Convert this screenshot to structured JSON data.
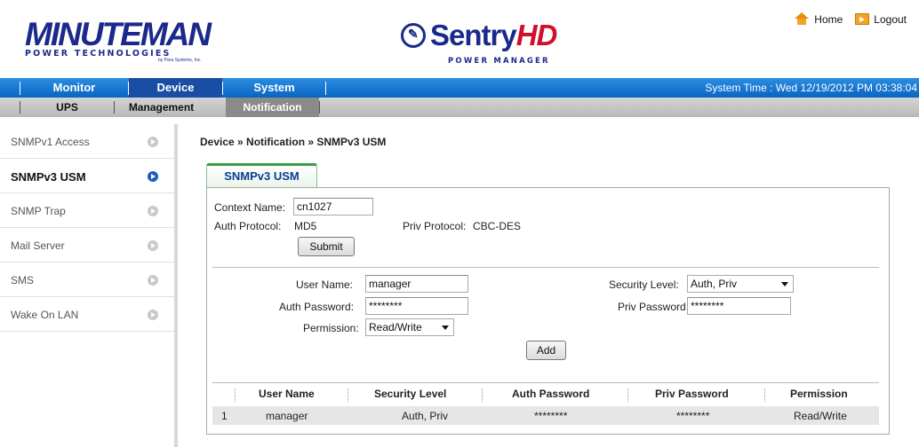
{
  "header": {
    "brand_main": "MINUTEMAN",
    "brand_sub": "POWER TECHNOLOGIES",
    "brand_sub2": "by Para Systems, Inc.",
    "product_name_a": "Sentry",
    "product_name_b": "HD",
    "product_sub": "POWER MANAGER",
    "home_label": "Home",
    "logout_label": "Logout"
  },
  "main_nav": {
    "tabs": [
      {
        "label": "Monitor"
      },
      {
        "label": "Device"
      },
      {
        "label": "System"
      }
    ],
    "active": "Device",
    "system_time": "System Time : Wed 12/19/2012 PM 03:38:04"
  },
  "sub_nav": {
    "tabs": [
      {
        "label": "UPS"
      },
      {
        "label": "Management"
      },
      {
        "label": "Notification"
      }
    ],
    "active": "Notification"
  },
  "sidebar": {
    "items": [
      {
        "label": "SNMPv1 Access"
      },
      {
        "label": "SNMPv3 USM"
      },
      {
        "label": "SNMP Trap"
      },
      {
        "label": "Mail Server"
      },
      {
        "label": "SMS"
      },
      {
        "label": "Wake On LAN"
      }
    ],
    "active": "SNMPv3 USM"
  },
  "breadcrumb": "Device » Notification » SNMPv3 USM",
  "content_tab": "SNMPv3 USM",
  "context": {
    "context_name_label": "Context Name:",
    "context_name_value": "cn1027",
    "auth_protocol_label": "Auth Protocol:",
    "auth_protocol_value": "MD5",
    "priv_protocol_label": "Priv Protocol:",
    "priv_protocol_value": "CBC-DES",
    "submit_label": "Submit"
  },
  "user_form": {
    "user_name_label": "User Name:",
    "user_name_value": "manager",
    "auth_password_label": "Auth Password:",
    "auth_password_value": "********",
    "permission_label": "Permission:",
    "permission_value": "Read/Write",
    "security_level_label": "Security Level:",
    "security_level_value": "Auth, Priv",
    "priv_password_label": "Priv Password:",
    "priv_password_value": "********",
    "add_label": "Add"
  },
  "users_table": {
    "headers": [
      "User Name",
      "Security Level",
      "Auth Password",
      "Priv Password",
      "Permission"
    ],
    "rows": [
      {
        "index": "1",
        "user_name": "manager",
        "security_level": "Auth, Priv",
        "auth_password": "********",
        "priv_password": "********",
        "permission": "Read/Write"
      }
    ]
  },
  "colors": {
    "nav_blue": "#0a63c2",
    "active_bullet": "#1d5fbf",
    "tab_green": "#3a9a45"
  }
}
